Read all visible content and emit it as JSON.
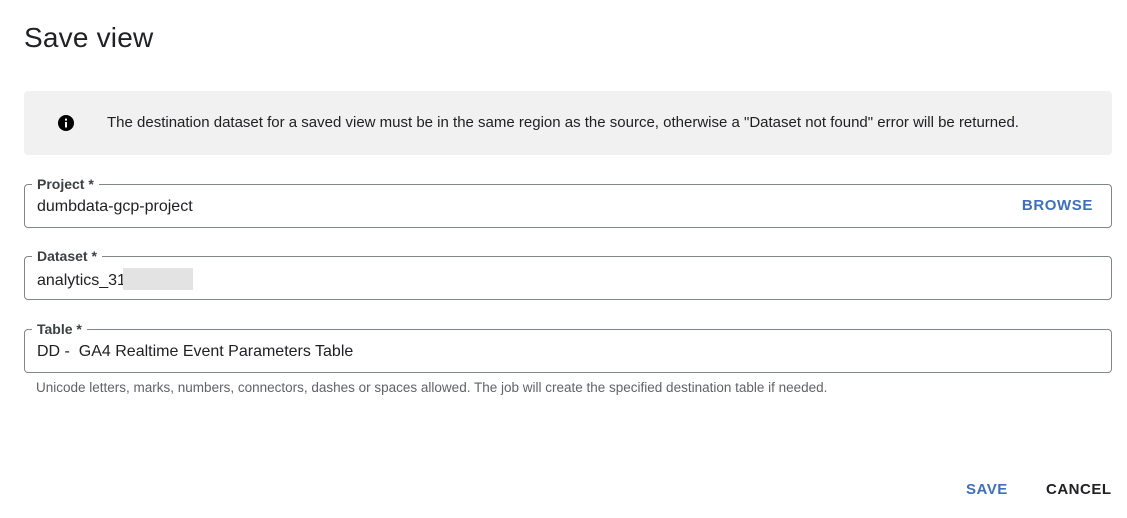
{
  "dialog": {
    "title": "Save view"
  },
  "info_banner": {
    "icon": "info-icon",
    "text": "The destination dataset for a saved view must be in the same region as the source, otherwise a \"Dataset not found\" error will be returned."
  },
  "fields": {
    "project": {
      "label": "Project *",
      "value": "dumbdata-gcp-project",
      "browse_label": "BROWSE"
    },
    "dataset": {
      "label": "Dataset *",
      "value": "analytics_31"
    },
    "table": {
      "label": "Table *",
      "value": "DD -  GA4 Realtime Event Parameters Table",
      "hint": "Unicode letters, marks, numbers, connectors, dashes or spaces allowed. The job will create the specified destination table if needed."
    }
  },
  "actions": {
    "save_label": "SAVE",
    "cancel_label": "CANCEL"
  },
  "colors": {
    "accent": "#3f6fbe",
    "banner_bg": "#f1f1f1",
    "border": "#80868b"
  }
}
